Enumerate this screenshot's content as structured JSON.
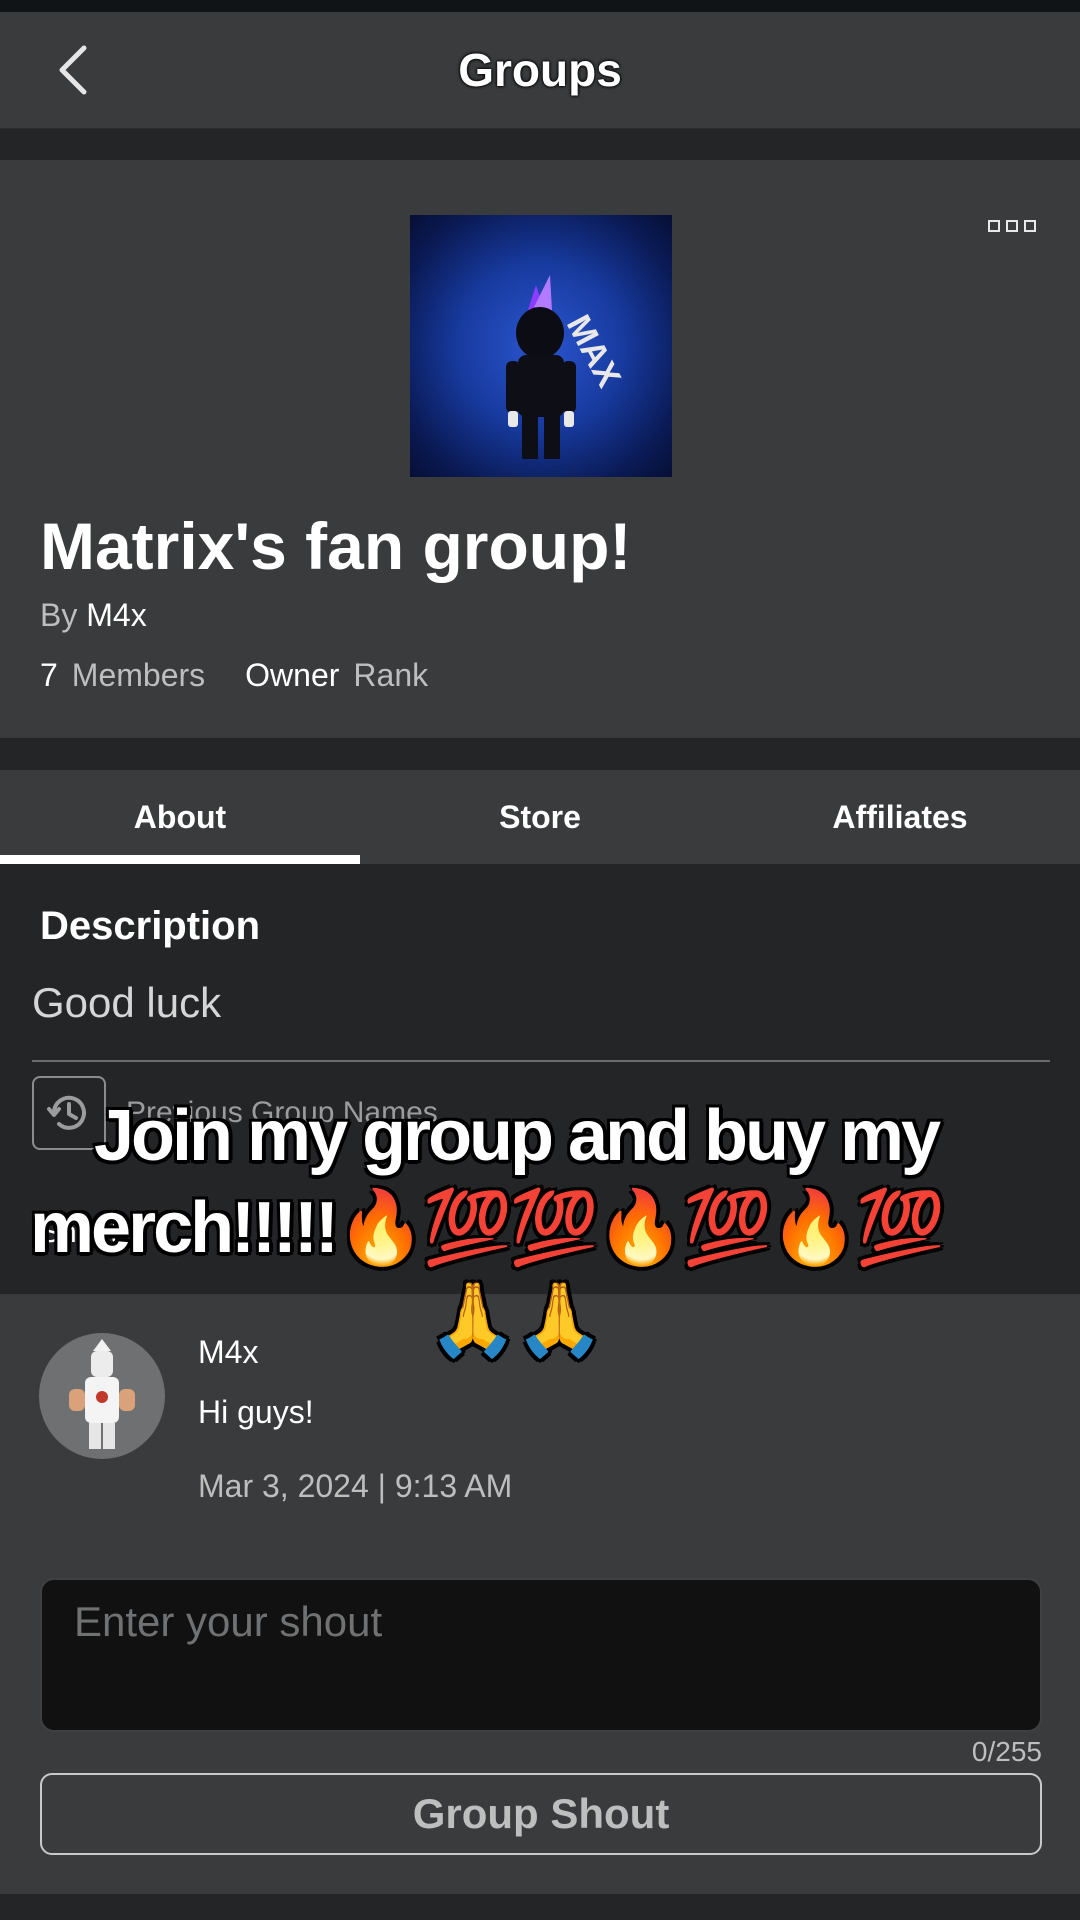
{
  "header": {
    "title": "Groups"
  },
  "group": {
    "name": "Matrix's fan group!",
    "by_label": "By",
    "owner": "M4x",
    "member_count": "7",
    "members_label": "Members",
    "rank_value": "Owner",
    "rank_label": "Rank",
    "image_text": "MAX"
  },
  "tabs": [
    {
      "label": "About",
      "active": true
    },
    {
      "label": "Store",
      "active": false
    },
    {
      "label": "Affiliates",
      "active": false
    }
  ],
  "about": {
    "description_title": "Description",
    "description_text": "Good luck",
    "previous_names_label": "Previous Group Names",
    "shout_label": "Shout"
  },
  "shout": {
    "poster": "M4x",
    "text": "Hi guys!",
    "timestamp": "Mar 3, 2024 | 9:13 AM",
    "input_placeholder": "Enter your shout",
    "char_count": "0/255",
    "button_label": "Group Shout"
  },
  "overlay": {
    "line1": "Join my group and buy my",
    "line2": "merch!!!!!🔥💯💯🔥💯🔥💯",
    "line3": "🙏🙏"
  },
  "colors": {
    "background": "#232527",
    "card": "#393b3d",
    "topbar": "#393b3d",
    "text_primary": "#ffffff",
    "text_secondary": "#bdbebe",
    "input_bg": "#111111"
  },
  "icons": {
    "back": "chevron-left-icon",
    "more": "more-options-icon",
    "history": "history-clock-icon"
  }
}
